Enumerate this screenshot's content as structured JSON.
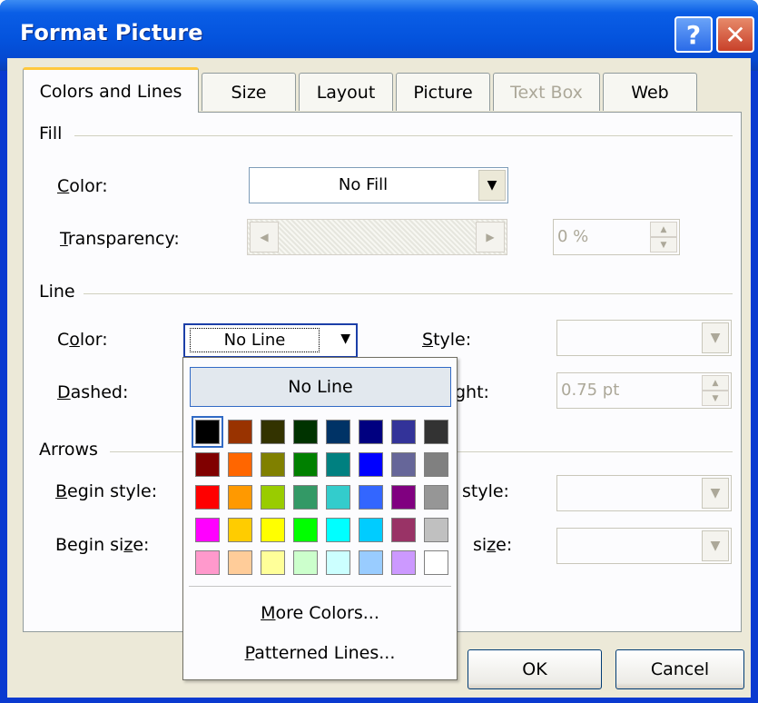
{
  "window": {
    "title": "Format Picture",
    "help_glyph": "?",
    "close_glyph": "✕"
  },
  "tabs": [
    {
      "label": "Colors and Lines",
      "active": true,
      "disabled": false
    },
    {
      "label": "Size",
      "active": false,
      "disabled": false
    },
    {
      "label": "Layout",
      "active": false,
      "disabled": false
    },
    {
      "label": "Picture",
      "active": false,
      "disabled": false
    },
    {
      "label": "Text Box",
      "active": false,
      "disabled": true
    },
    {
      "label": "Web",
      "active": false,
      "disabled": false
    }
  ],
  "fill": {
    "group_label": "Fill",
    "color_label_pre": "",
    "color_label_u": "C",
    "color_label_post": "olor:",
    "color_value": "No Fill",
    "transparency_label_pre": "",
    "transparency_label_u": "T",
    "transparency_label_post": "ransparency:",
    "transparency_value": "0 %"
  },
  "line": {
    "group_label": "Line",
    "color_label_pre": "C",
    "color_label_u": "o",
    "color_label_post": "lor:",
    "color_value": "No Line",
    "style_label_pre": "",
    "style_label_u": "S",
    "style_label_post": "tyle:",
    "dashed_label_pre": "",
    "dashed_label_u": "D",
    "dashed_label_post": "ashed:",
    "weight_label_partial": "ght:",
    "weight_value": "0.75 pt"
  },
  "arrows": {
    "group_label": "Arrows",
    "begin_style_label_pre": "",
    "begin_style_label_u": "B",
    "begin_style_label_post": "egin style:",
    "begin_size_label_pre": "Begin si",
    "begin_size_label_u": "z",
    "begin_size_label_post": "e:",
    "end_style_partial": "style:",
    "end_size_partial_pre": "si",
    "end_size_partial_u": "z",
    "end_size_partial_post": "e:"
  },
  "buttons": {
    "ok": "OK",
    "cancel": "Cancel"
  },
  "color_popup": {
    "no_line": "No Line",
    "more_colors_pre": "",
    "more_colors_u": "M",
    "more_colors_post": "ore Colors...",
    "patterned_pre": "",
    "patterned_u": "P",
    "patterned_post": "atterned Lines...",
    "selected_swatch": 0,
    "swatches": [
      [
        "#000000",
        "#993300",
        "#333300",
        "#003300",
        "#003366",
        "#000080",
        "#333399",
        "#333333"
      ],
      [
        "#800000",
        "#FF6600",
        "#808000",
        "#008000",
        "#008080",
        "#0000FF",
        "#666699",
        "#808080"
      ],
      [
        "#FF0000",
        "#FF9900",
        "#99CC00",
        "#339966",
        "#33CCCC",
        "#3366FF",
        "#800080",
        "#969696"
      ],
      [
        "#FF00FF",
        "#FFCC00",
        "#FFFF00",
        "#00FF00",
        "#00FFFF",
        "#00CCFF",
        "#993366",
        "#C0C0C0"
      ],
      [
        "#FF99CC",
        "#FFCC99",
        "#FFFF99",
        "#CCFFCC",
        "#CCFFFF",
        "#99CCFF",
        "#CC99FF",
        "#FFFFFF"
      ]
    ]
  },
  "icons": {
    "dropdown": "▼",
    "scroll_left": "◀",
    "scroll_right": "▶",
    "spin_up": "▲",
    "spin_down": "▼"
  }
}
